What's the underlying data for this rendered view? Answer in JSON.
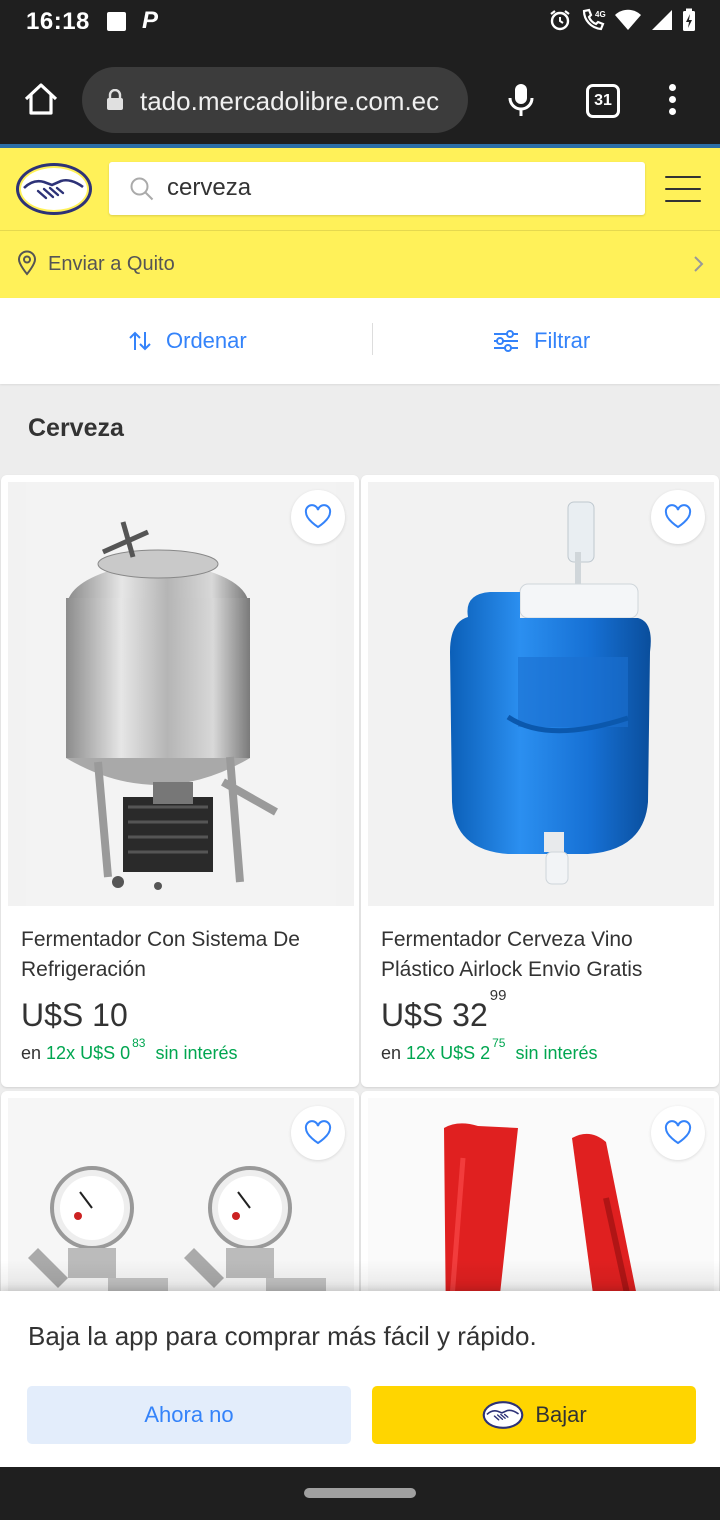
{
  "status_bar": {
    "time": "16:18",
    "network": "4G"
  },
  "browser": {
    "url": "tado.mercadolibre.com.ec",
    "tab_count": "31"
  },
  "header": {
    "search_value": "cerveza",
    "deliver_text": "Enviar a Quito"
  },
  "toolbar": {
    "sort_label": "Ordenar",
    "filter_label": "Filtrar"
  },
  "section_title": "Cerveza",
  "products": [
    {
      "title": "Fermentador Con Sistema De Refrigeración",
      "price_main": "U$S 10",
      "price_cents": "",
      "inst_prefix": "en",
      "inst_count": "12x",
      "inst_amount": "U$S 0",
      "inst_cents": "83",
      "inst_suffix": "sin interés"
    },
    {
      "title": "Fermentador Cerveza Vino Plástico Airlock Envio Gratis",
      "price_main": "U$S 32",
      "price_cents": "99",
      "inst_prefix": "en",
      "inst_count": "12x",
      "inst_amount": "U$S 2",
      "inst_cents": "75",
      "inst_suffix": "sin interés"
    }
  ],
  "app_banner": {
    "message": "Baja la app para comprar más fácil y rápido.",
    "dismiss_label": "Ahora no",
    "download_label": "Bajar"
  },
  "colors": {
    "brand_yellow": "#fff159",
    "link_blue": "#3483fa",
    "green": "#00a650",
    "button_yellow": "#ffd500"
  }
}
